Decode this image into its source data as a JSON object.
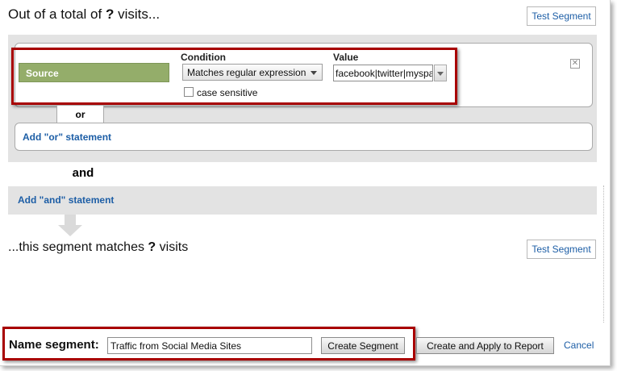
{
  "header": {
    "prefix": "Out of a total of",
    "unknown": "?",
    "suffix": "visits...",
    "test_button": "Test Segment"
  },
  "condition_row": {
    "dimension": "Source",
    "condition_label": "Condition",
    "condition_value": "Matches regular expression",
    "value_label": "Value",
    "value_text": "facebook|twitter|myspace",
    "case_sensitive_label": "case sensitive",
    "case_sensitive_checked": false,
    "remove_icon": "close-icon"
  },
  "or_label": "or",
  "add_or_link": "Add \"or\" statement",
  "and_label": "and",
  "add_and_link": "Add \"and\" statement",
  "result": {
    "prefix": "...this segment matches",
    "unknown": "?",
    "suffix": "visits",
    "test_button": "Test Segment"
  },
  "footer": {
    "name_label": "Name segment:",
    "name_value": "Traffic from Social Media Sites",
    "create_button": "Create Segment",
    "create_apply_button": "Create and Apply to Report",
    "cancel_link": "Cancel"
  },
  "colors": {
    "source_pill": "#94ad6a",
    "highlight_box": "#a80000",
    "link": "#1d5ea6",
    "panel_gray": "#e3e3e3"
  }
}
